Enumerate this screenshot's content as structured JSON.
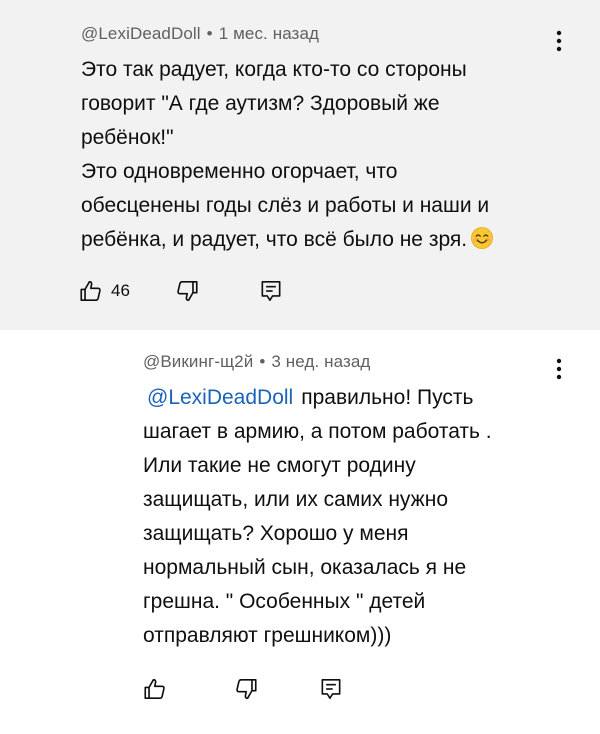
{
  "comments": [
    {
      "author": "@LexiDeadDoll",
      "separator": "•",
      "time": "1 мес. назад",
      "lines": [
        "Это так радует, когда кто-то со стороны",
        "говорит \"А где аутизм?  Здоровый же",
        "ребёнок!\"",
        "Это одновременно огорчает, что",
        "обесценены годы слёз и работы и наши и",
        "ребёнка,  и радует, что всё было не зря."
      ],
      "emoji": "smiling-face-emoji",
      "like_count": "46",
      "icons": {
        "menu": "more-vert-icon",
        "like": "thumb-up-icon",
        "dislike": "thumb-down-icon",
        "reply": "reply-comment-icon"
      }
    },
    {
      "author": "@Викинг-щ2й",
      "separator": "•",
      "time": "3 нед. назад",
      "mention": "@LexiDeadDoll",
      "lines": [
        "правильно! Пусть",
        "шагает в армию, а потом работать .",
        "Или такие не смогут родину",
        "защищать, или их самих нужно",
        "защищать? Хорошо у меня",
        "нормальный сын, оказалась я не",
        "грешна. \" Особенных \" детей",
        "отправляют грешником)))"
      ],
      "icons": {
        "menu": "more-vert-icon",
        "like": "thumb-up-icon",
        "dislike": "thumb-down-icon",
        "reply": "reply-comment-icon"
      }
    }
  ],
  "colors": {
    "main_background": "#f2f2f2",
    "reply_background": "#ffffff",
    "meta_text": "#606060",
    "body_text": "#0f0f0f",
    "mention": "#1c62b9"
  }
}
